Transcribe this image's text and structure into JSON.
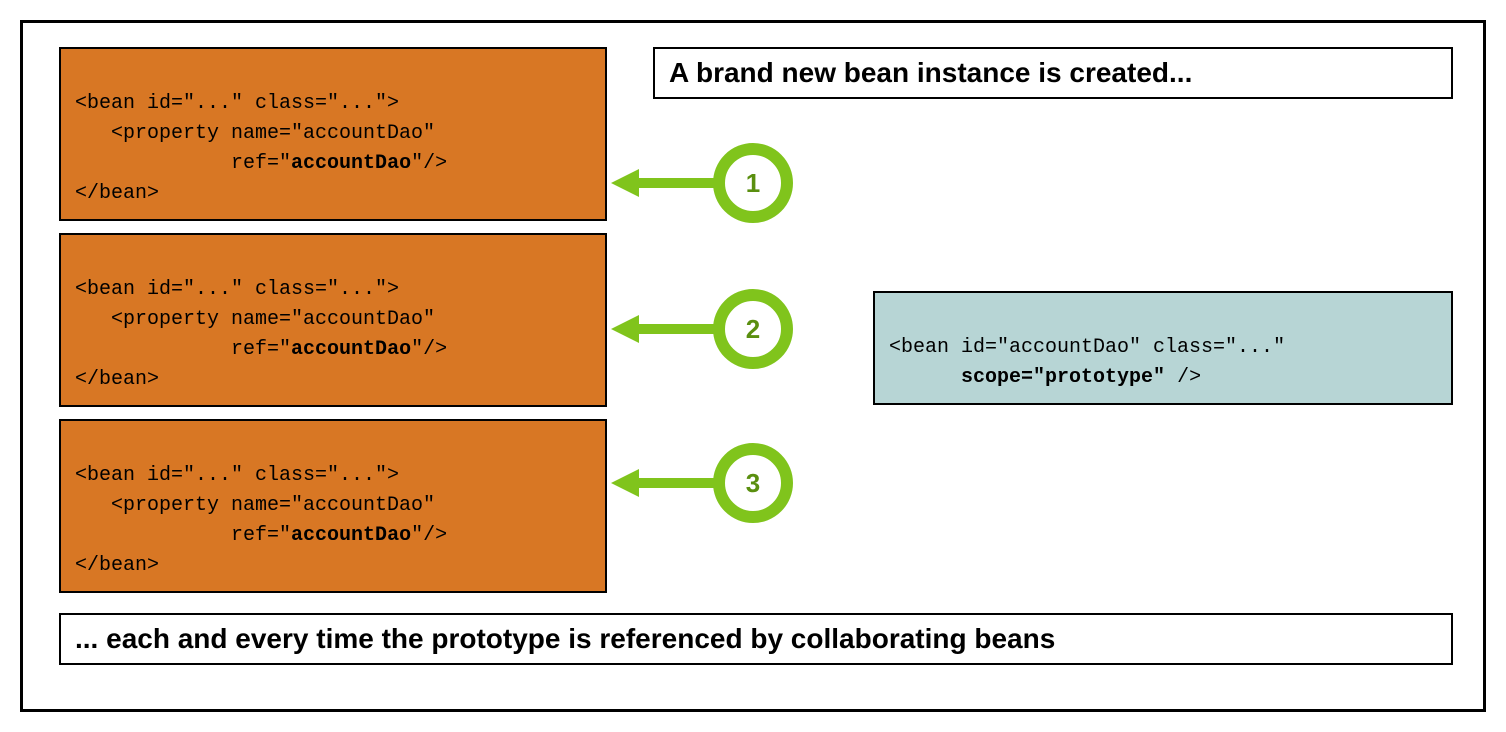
{
  "heading_top": "A brand new bean instance is created...",
  "heading_bottom": "... each and every time the prototype is referenced by collaborating beans",
  "bean_boxes": [
    {
      "line1": "<bean id=\"...\" class=\"...\">",
      "line2": "   <property name=\"accountDao\"",
      "line3_prefix": "             ref=\"",
      "line3_bold": "accountDao",
      "line3_suffix": "\"/>",
      "line4": "</bean>"
    },
    {
      "line1": "<bean id=\"...\" class=\"...\">",
      "line2": "   <property name=\"accountDao\"",
      "line3_prefix": "             ref=\"",
      "line3_bold": "accountDao",
      "line3_suffix": "\"/>",
      "line4": "</bean>"
    },
    {
      "line1": "<bean id=\"...\" class=\"...\">",
      "line2": "   <property name=\"accountDao\"",
      "line3_prefix": "             ref=\"",
      "line3_bold": "accountDao",
      "line3_suffix": "\"/>",
      "line4": "</bean>"
    }
  ],
  "proto_box": {
    "line1": "<bean id=\"accountDao\" class=\"...\"",
    "line2_prefix": "      ",
    "line2_bold": "scope=\"prototype\"",
    "line2_suffix": " />"
  },
  "circles": [
    "1",
    "2",
    "3"
  ]
}
